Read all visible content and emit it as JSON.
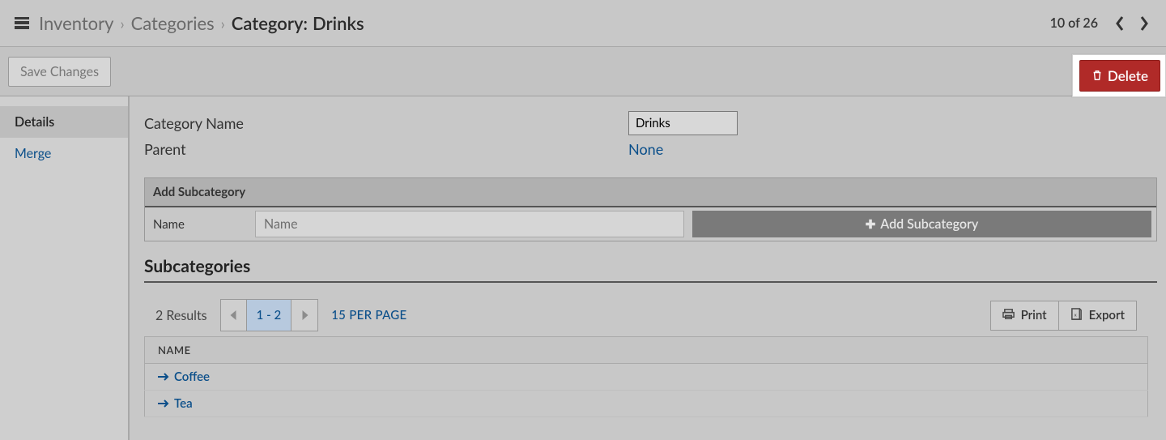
{
  "breadcrumb": {
    "items": [
      "Inventory",
      "Categories",
      "Category:"
    ],
    "current": "Drinks"
  },
  "pager_top": {
    "text": "10 of 26"
  },
  "actions": {
    "save": "Save Changes",
    "delete": "Delete"
  },
  "sidebar": {
    "items": [
      {
        "label": "Details",
        "active": true
      },
      {
        "label": "Merge",
        "active": false
      }
    ]
  },
  "form": {
    "name_label": "Category Name",
    "name_value": "Drinks",
    "parent_label": "Parent",
    "parent_value": "None"
  },
  "add_sub": {
    "title": "Add Subcategory",
    "field_label": "Name",
    "placeholder": "Name",
    "button": "Add Subcategory"
  },
  "subcats": {
    "heading": "Subcategories",
    "results_text": "2 Results",
    "page_range": "1 - 2",
    "per_page": "15 PER PAGE",
    "print": "Print",
    "export": "Export",
    "col_name": "NAME",
    "rows": [
      {
        "name": "Coffee"
      },
      {
        "name": "Tea"
      }
    ]
  }
}
